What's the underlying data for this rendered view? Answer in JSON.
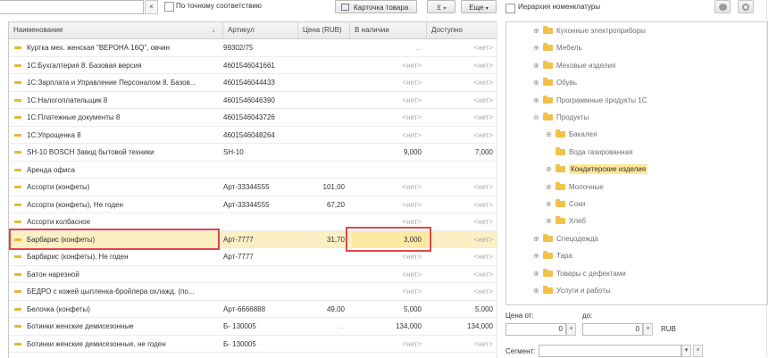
{
  "toolbar": {
    "clear_label": "×",
    "exact_match_label": "По точному соответствию",
    "card_button_label": "Карточка товара",
    "more_button_label": "Еще",
    "hierarchy_label": "Иерархия номенклатуры"
  },
  "table": {
    "columns": [
      "Наименование",
      "Артикул",
      "Цена (RUB)",
      "В наличии",
      "Доступно"
    ],
    "sort_indicator": "↓",
    "rows": [
      {
        "name": "Куртка мех. женская \"ВЕРОНА 16Q\", овчин",
        "art": "99302/75",
        "price": "",
        "stock": "...",
        "avail": "<нет>"
      },
      {
        "name": "1С:Бухгалтерия 8. Базовая версия",
        "art": "4601546041661",
        "price": "",
        "stock": "<нет>",
        "avail": "<нет>"
      },
      {
        "name": "1С:Зарплата и Управление Персоналом 8. Базов...",
        "art": "4601546044433",
        "price": "",
        "stock": "<нет>",
        "avail": "<нет>"
      },
      {
        "name": "1С:Налогоплательщик 8",
        "art": "4601546046390",
        "price": "",
        "stock": "<нет>",
        "avail": "<нет>"
      },
      {
        "name": "1С:Платежные документы 8",
        "art": "4601546043726",
        "price": "",
        "stock": "<нет>",
        "avail": "<нет>"
      },
      {
        "name": "1С:Упрощенка 8",
        "art": "4601546048264",
        "price": "",
        "stock": "<нет>",
        "avail": "<нет>"
      },
      {
        "name": "SH-10 BOSCH Завод бытовой техники",
        "art": "SH-10",
        "price": "",
        "stock": "9,000",
        "avail": "7,000"
      },
      {
        "name": "Аренда офиса",
        "art": "",
        "price": "",
        "stock": "",
        "avail": ""
      },
      {
        "name": "Ассорти (конфеты)",
        "art": "Арт-33344555",
        "price": "101,00",
        "stock": "<нет>",
        "avail": "<нет>"
      },
      {
        "name": "Ассорти (конфеты), Не годен",
        "art": "Арт-33344555",
        "price": "67,20",
        "stock": "<нет>",
        "avail": "<нет>"
      },
      {
        "name": "Ассорти колбасное",
        "art": "",
        "price": "",
        "stock": "<нет>",
        "avail": "<нет>"
      },
      {
        "name": "Барбарис (конфеты)",
        "art": "Арт-7777",
        "price": "31,70",
        "stock": "3,000",
        "avail": "<нет>"
      },
      {
        "name": "Барбарис (конфеты), Не годен",
        "art": "Арт-7777",
        "price": "",
        "stock": "<нет>",
        "avail": "<нет>"
      },
      {
        "name": "Батон нарезной",
        "art": "",
        "price": "",
        "stock": "<нет>",
        "avail": "<нет>"
      },
      {
        "name": "БЕДРО с кожей цыпленка-бройлера охлажд. (по...",
        "art": "",
        "price": "",
        "stock": "<нет>",
        "avail": "<нет>"
      },
      {
        "name": "Белочка (конфеты)",
        "art": "Арт-6666888",
        "price": "49,00",
        "stock": "5,000",
        "avail": "5,000"
      },
      {
        "name": "Ботинки женские демисезонные",
        "art": "Б- 130005",
        "price": "...",
        "stock": "134,000",
        "avail": "134,000"
      },
      {
        "name": "Ботинки женские демисезонные, не годен",
        "art": "Б- 130005",
        "price": "",
        "stock": "<нет>",
        "avail": "<нет>"
      }
    ]
  },
  "tree": {
    "nodes": [
      {
        "label": "Кухонные электроприборы",
        "level": 0,
        "expander": "⊕"
      },
      {
        "label": "Мебель",
        "level": 0,
        "expander": "⊕"
      },
      {
        "label": "Меховые изделия",
        "level": 0,
        "expander": "⊕"
      },
      {
        "label": "Обувь",
        "level": 0,
        "expander": "⊕"
      },
      {
        "label": "Программные продукты 1С",
        "level": 0,
        "expander": "⊕"
      },
      {
        "label": "Продукты",
        "level": 0,
        "expander": "⊖"
      },
      {
        "label": "Бакалея",
        "level": 1,
        "expander": "⊕"
      },
      {
        "label": "Вода газированная",
        "level": 1,
        "expander": ""
      },
      {
        "label": "Кондитерские изделия",
        "level": 1,
        "expander": "⊕",
        "selected": true
      },
      {
        "label": "Молочные",
        "level": 1,
        "expander": "⊕"
      },
      {
        "label": "Соки",
        "level": 1,
        "expander": "⊕"
      },
      {
        "label": "Хлеб",
        "level": 1,
        "expander": "⊕"
      },
      {
        "label": "Спецодежда",
        "level": 0,
        "expander": "⊕"
      },
      {
        "label": "Тара",
        "level": 0,
        "expander": "⊕"
      },
      {
        "label": "Товары с дефектами",
        "level": 0,
        "expander": "⊕"
      },
      {
        "label": "Услуги и работы",
        "level": 0,
        "expander": "⊕"
      }
    ]
  },
  "filters": {
    "price_from_label": "Цена от:",
    "price_to_label": "до:",
    "price_from_value": "0",
    "price_to_value": "0",
    "currency": "RUB",
    "segment_label": "Сегмент:",
    "clear": "×"
  },
  "colors": {
    "selected_row": "#fbefc4",
    "highlight_border": "#e0474a",
    "folder": "#f1c14a"
  }
}
